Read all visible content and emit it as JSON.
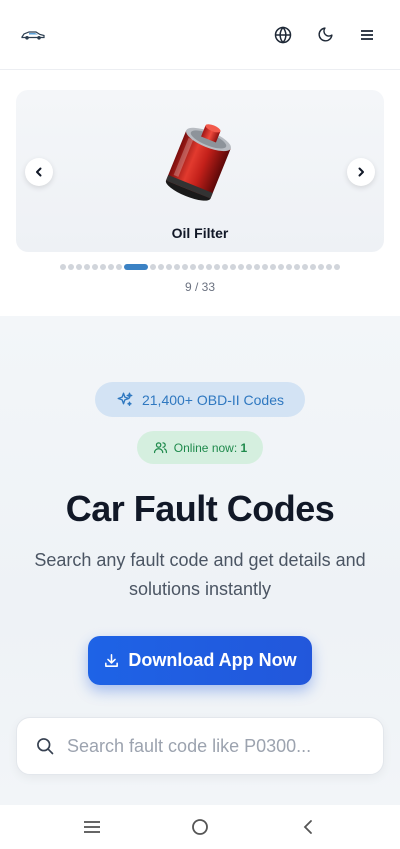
{
  "header": {
    "logo_icon": "car-icon",
    "actions": [
      {
        "name": "language-button",
        "icon": "globe-icon"
      },
      {
        "name": "theme-toggle-button",
        "icon": "moon-icon"
      },
      {
        "name": "menu-button",
        "icon": "hamburger-menu-icon"
      }
    ]
  },
  "carousel": {
    "current_item": "Oil Filter",
    "current_index": 9,
    "total": 33,
    "counter_text": "9 / 33",
    "prev_icon": "chevron-left-icon",
    "next_icon": "chevron-right-icon"
  },
  "hero": {
    "codes_badge": "21,400+ OBD-II Codes",
    "online_label": "Online now:",
    "online_count": "1",
    "title": "Car Fault Codes",
    "subtitle": "Search any fault code and get details and solutions instantly",
    "download_label": "Download App Now"
  },
  "search": {
    "placeholder": "Search fault code like P0300...",
    "value": ""
  },
  "colors": {
    "accent_blue": "#1e63e6",
    "badge_blue_bg": "#d3e3f4",
    "badge_green_bg": "#d5efdf",
    "dot_active": "#3b82c4"
  },
  "system_nav": {
    "buttons": [
      "recent-apps-icon",
      "home-icon",
      "back-icon"
    ]
  }
}
